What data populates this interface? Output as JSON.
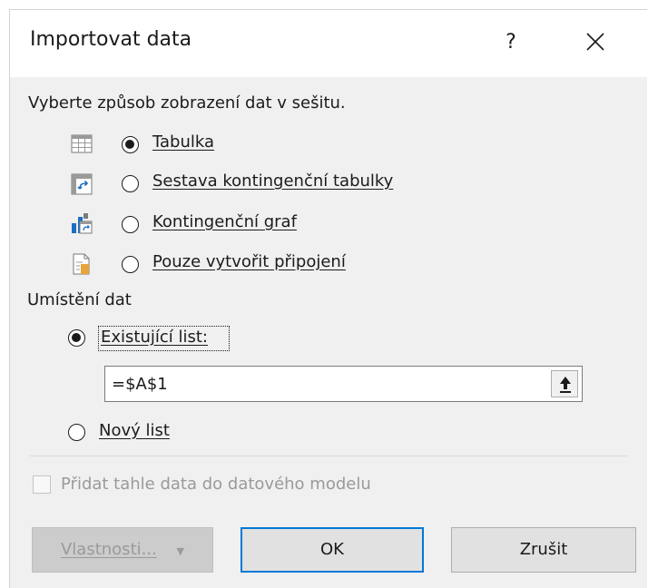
{
  "dialog": {
    "title": "Importovat data",
    "help_label": "?",
    "close_icon": "close-icon"
  },
  "view_section": {
    "heading": "Vyberte způsob zobrazení dat v sešitu.",
    "options": [
      {
        "label": "Tabulka",
        "icon": "table-icon",
        "selected": true
      },
      {
        "label": "Sestava kontingenční tabulky",
        "icon": "pivot-table-icon",
        "selected": false
      },
      {
        "label": "Kontingenční graf",
        "icon": "pivot-chart-icon",
        "selected": false
      },
      {
        "label": "Pouze vytvořit připojení",
        "icon": "connection-only-icon",
        "selected": false
      }
    ]
  },
  "location_section": {
    "heading": "Umístění dat",
    "existing_label": "Existující list:",
    "existing_selected": true,
    "reference_value": "=$A$1",
    "collapse_icon": "collapse-dialog-icon",
    "new_label": "Nový list",
    "new_selected": false
  },
  "data_model": {
    "label": "Přidat tahle data do datového modelu",
    "checked": false,
    "enabled": false
  },
  "buttons": {
    "properties": "Vlastnosti...",
    "ok": "OK",
    "cancel": "Zrušit"
  },
  "colors": {
    "accent": "#0078d7",
    "dialog_background": "#f0f0f0"
  }
}
